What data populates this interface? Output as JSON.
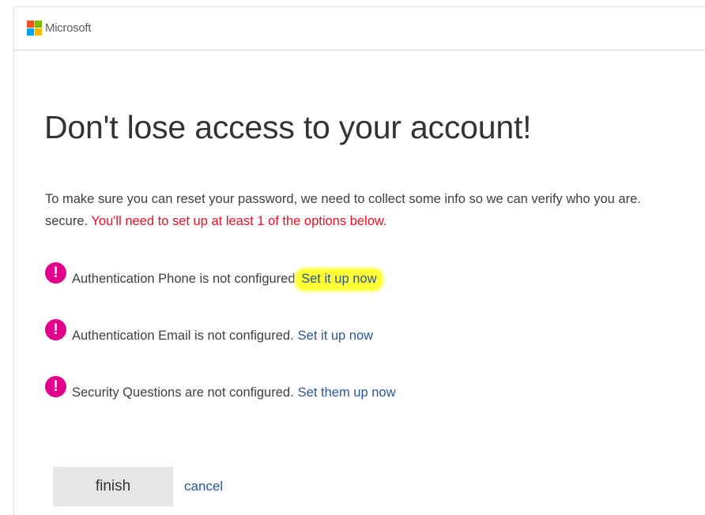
{
  "brand": {
    "name": "Microsoft",
    "logo_colors": [
      "#f25022",
      "#7fba00",
      "#00a4ef",
      "#ffb900"
    ]
  },
  "title": "Don't lose access to your account!",
  "intro": {
    "line1": "To make sure you can reset your password, we need to collect some info so we can verify who you are.",
    "line2_prefix": "secure.",
    "line2_warning": "You'll need to set up at least 1 of the options below."
  },
  "items": [
    {
      "icon": "alert-icon",
      "text": "Authentication Phone is not configured.",
      "link": "Set it up now"
    },
    {
      "icon": "alert-icon",
      "text": "Authentication Email is not configured.",
      "link": "Set it up now"
    },
    {
      "icon": "alert-icon",
      "text": "Security Questions are not configured.",
      "link": "Set them up now"
    }
  ],
  "icon_glyph": "!",
  "actions": {
    "finish": "finish",
    "cancel": "cancel"
  },
  "colors": {
    "alert": "#e3008c",
    "link": "#2b5797",
    "warning": "#e81123",
    "highlight": "#ffff33"
  }
}
